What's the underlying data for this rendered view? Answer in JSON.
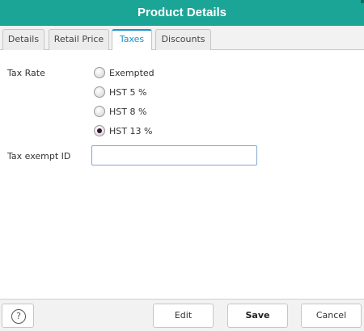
{
  "dialog": {
    "title": "Product Details"
  },
  "tabs": [
    {
      "label": "Details"
    },
    {
      "label": "Retail Price"
    },
    {
      "label": "Taxes"
    },
    {
      "label": "Discounts"
    }
  ],
  "active_tab": "Taxes",
  "tax_rate": {
    "label": "Tax Rate",
    "options": [
      {
        "label": "Exempted",
        "selected": false
      },
      {
        "label": "HST 5 %",
        "selected": false
      },
      {
        "label": "HST 8 %",
        "selected": false
      },
      {
        "label": "HST 13 %",
        "selected": true
      }
    ]
  },
  "tax_exempt_id": {
    "label": "Tax exempt ID",
    "value": "",
    "placeholder": ""
  },
  "footer": {
    "help_label": "?",
    "edit_label": "Edit",
    "save_label": "Save",
    "cancel_label": "Cancel"
  },
  "colors": {
    "title_bar": "#1ba597",
    "active_tab_accent": "#1a93c9",
    "input_border": "#7fa9d6"
  }
}
